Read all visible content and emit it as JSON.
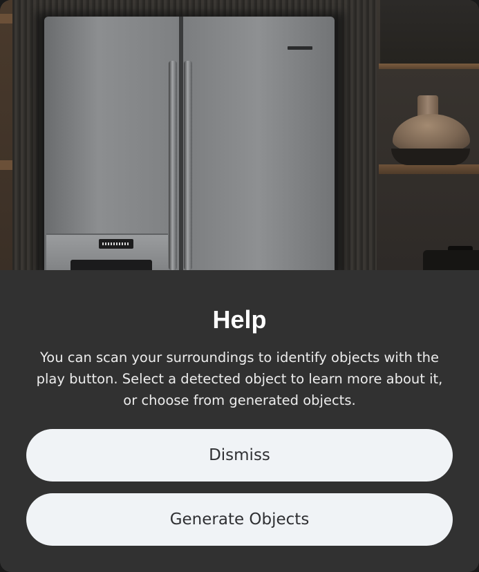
{
  "help_dialog": {
    "title": "Help",
    "message": "You can scan your surroundings to identify objects with the play button. Select a detected object to learn more about it, or choose from generated objects.",
    "buttons": {
      "dismiss_label": "Dismiss",
      "generate_label": "Generate Objects"
    }
  },
  "colors": {
    "sheet_background": "#313131",
    "button_background": "#f0f3f6",
    "button_text": "#2f3033",
    "title_text": "#ffffff"
  }
}
